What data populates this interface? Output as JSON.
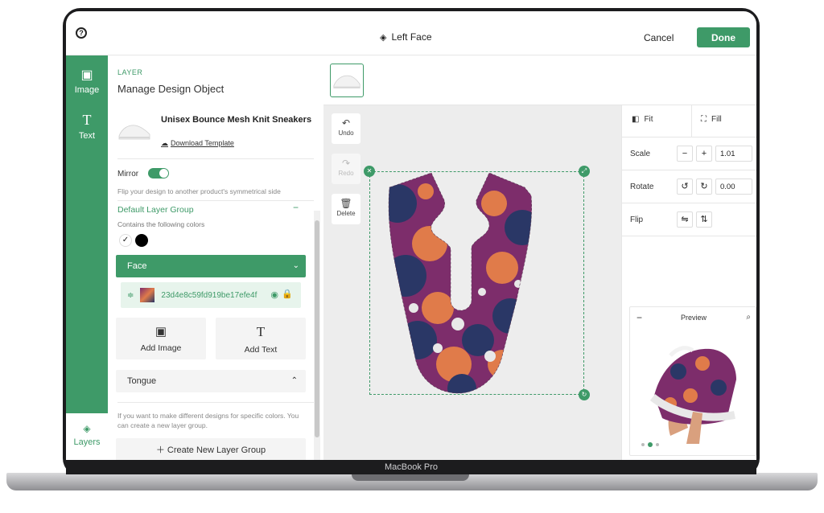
{
  "device_label": "MacBook Pro",
  "header": {
    "title": "Left Face",
    "cancel_label": "Cancel",
    "done_label": "Done"
  },
  "rail": {
    "image_label": "Image",
    "text_label": "Text",
    "layers_label": "Layers"
  },
  "panel": {
    "eyebrow": "LAYER",
    "title": "Manage Design Object",
    "product_name": "Unisex Bounce Mesh Knit Sneakers",
    "download_label": "Download Template",
    "mirror_label": "Mirror",
    "mirror_on": true,
    "mirror_desc": "Flip your design to another product's symmetrical side",
    "group_title": "Default Layer Group",
    "group_sub": "Contains the following colors",
    "colors": [
      "#ffffff",
      "#000000"
    ],
    "face_label": "Face",
    "layer_name": "23d4e8c59fd919be17efe4f",
    "add_image_label": "Add Image",
    "add_text_label": "Add Text",
    "tongue_label": "Tongue",
    "info_text": "If you want to make different designs for specific colors. You can create a new layer group.",
    "create_label": "Create New Layer Group"
  },
  "toolbar": {
    "undo_label": "Undo",
    "redo_label": "Redo",
    "delete_label": "Delete"
  },
  "props": {
    "fit_label": "Fit",
    "fill_label": "Fill",
    "scale_label": "Scale",
    "scale_value": "1.01",
    "rotate_label": "Rotate",
    "rotate_value": "0.00",
    "flip_label": "Flip"
  },
  "preview": {
    "title": "Preview",
    "pages": 3,
    "active_page": 2
  },
  "colors": {
    "accent": "#3e9a68",
    "pattern": [
      "#7d2d6b",
      "#e07b4a",
      "#2a3766",
      "#e8e8e8"
    ]
  }
}
